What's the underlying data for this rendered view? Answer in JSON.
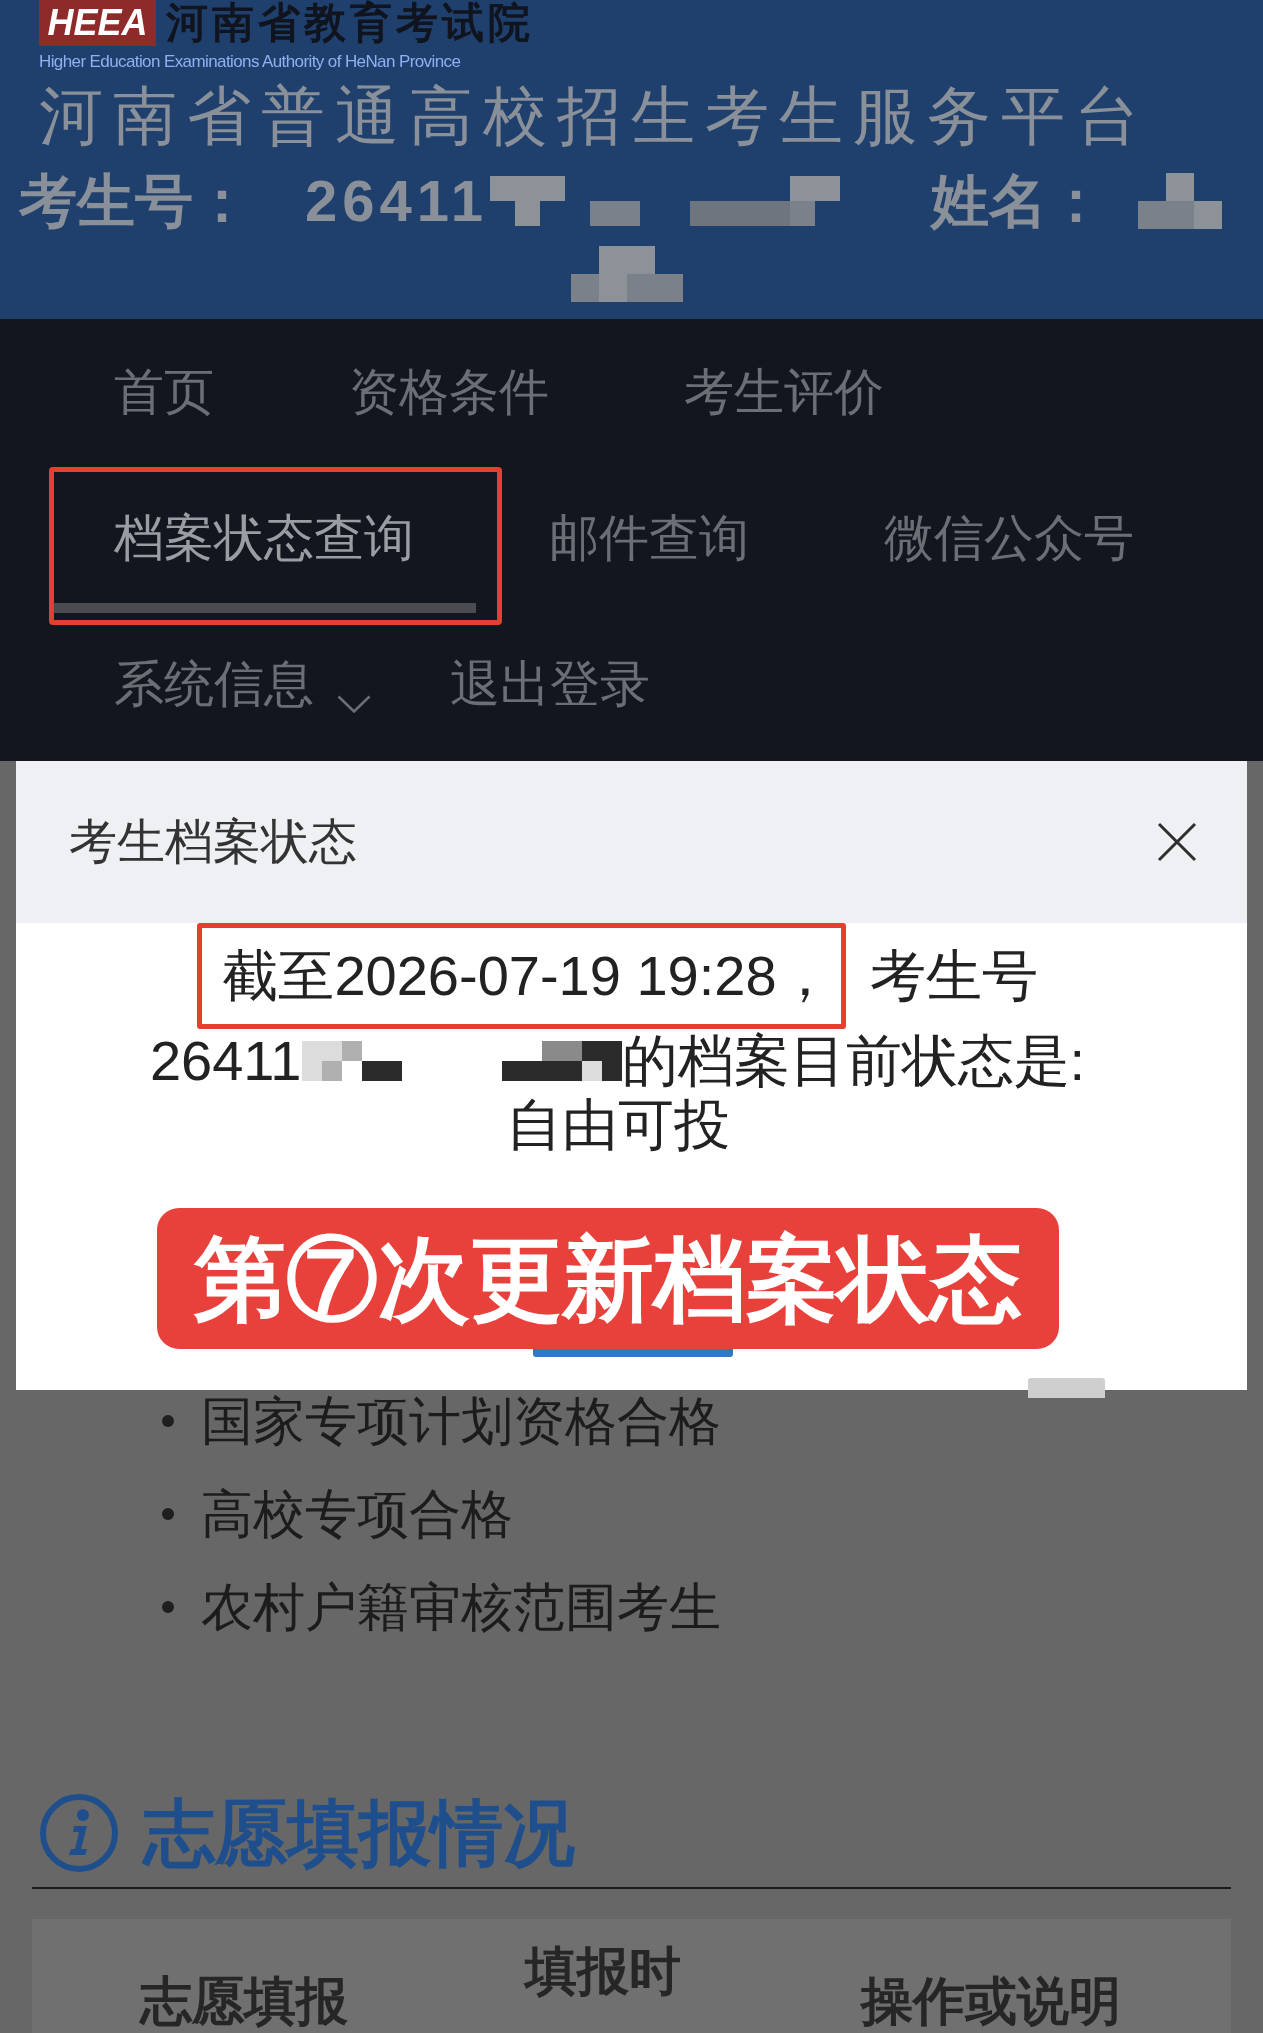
{
  "header": {
    "logo": {
      "mark": "HEEA",
      "name": "河南省教育考试院",
      "subtitle": "Higher Education Examinations Authority of HeNan Province"
    },
    "title": "河南省普通高校招生考生服务平台",
    "fields": [
      {
        "label": "考生号：",
        "value": "26411",
        "redacted": true
      },
      {
        "label": "姓名：",
        "redacted": true
      }
    ]
  },
  "nav": {
    "rows": [
      [
        {
          "label": "首页",
          "kind": "link",
          "selected": false,
          "highlighted": false
        },
        {
          "label": "资格条件",
          "kind": "link",
          "selected": false,
          "highlighted": false
        },
        {
          "label": "考生评价",
          "kind": "link",
          "selected": false,
          "highlighted": false
        }
      ],
      [
        {
          "label": "档案状态查询",
          "kind": "link",
          "selected": true,
          "highlighted": true
        },
        {
          "label": "邮件查询",
          "kind": "link",
          "selected": false,
          "highlighted": false
        },
        {
          "label": "微信公众号",
          "kind": "link",
          "selected": false,
          "highlighted": false
        }
      ],
      [
        {
          "label": "系统信息",
          "kind": "dropdown",
          "selected": false,
          "highlighted": false
        },
        {
          "label": "退出登录",
          "kind": "link",
          "selected": false,
          "highlighted": false
        }
      ]
    ]
  },
  "dialog": {
    "title": "考生档案状态",
    "message_lines": [
      [
        {
          "kind": "text",
          "text": "截至2026-07-19 19:28，",
          "highlighted": true
        },
        {
          "kind": "text",
          "text": "考生号",
          "highlighted": false
        }
      ],
      [
        {
          "kind": "text",
          "text": "26411",
          "highlighted": false
        },
        {
          "kind": "redaction"
        },
        {
          "kind": "text",
          "text": "的档案目前状态是:",
          "highlighted": false
        }
      ],
      [
        {
          "kind": "text",
          "text": "自由可投",
          "highlighted": false
        }
      ]
    ],
    "caption": "第⑦次更新档案状态"
  },
  "list": [
    "国家专项计划资格合格",
    "高校专项合格",
    "农村户籍审核范围考生"
  ],
  "section": {
    "title": "志愿填报情况",
    "table": {
      "columns": [
        "志愿填报",
        "填报时",
        "操作或说明"
      ]
    }
  }
}
